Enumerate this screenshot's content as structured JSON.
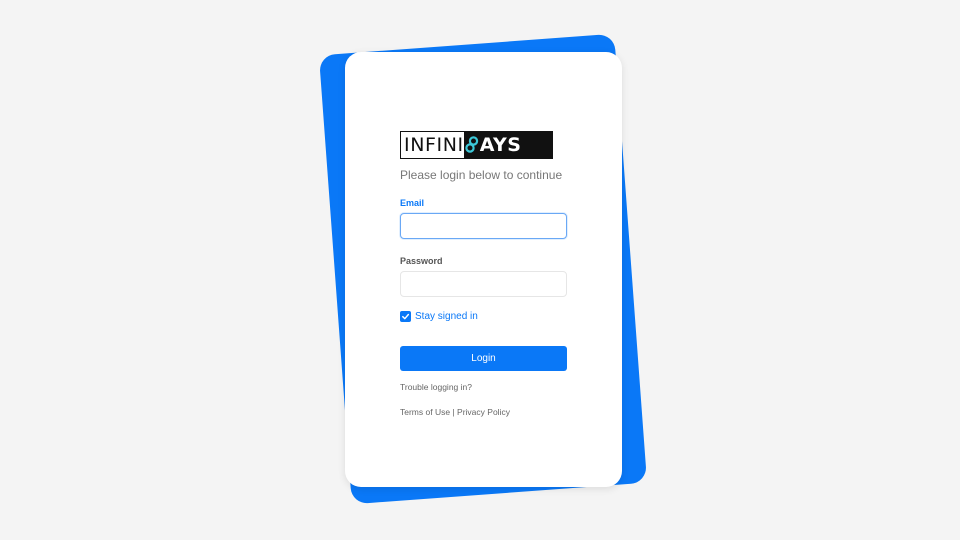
{
  "brand": {
    "logo_left_text": "INFINI",
    "logo_right_text": "AYS",
    "logo_mark_icon": "infinity-p-icon",
    "accent_color": "#0a78f7",
    "logo_mark_color": "#3cc8d8"
  },
  "login": {
    "subtitle": "Please login below to continue",
    "email_label": "Email",
    "email_value": "",
    "password_label": "Password",
    "password_value": "",
    "stay_signed_in_label": "Stay signed in",
    "stay_signed_in_checked": true,
    "login_button_label": "Login",
    "trouble_link": "Trouble logging in?"
  },
  "footer": {
    "terms_link": "Terms of Use",
    "separator": "|",
    "privacy_link": "Privacy Policy"
  }
}
